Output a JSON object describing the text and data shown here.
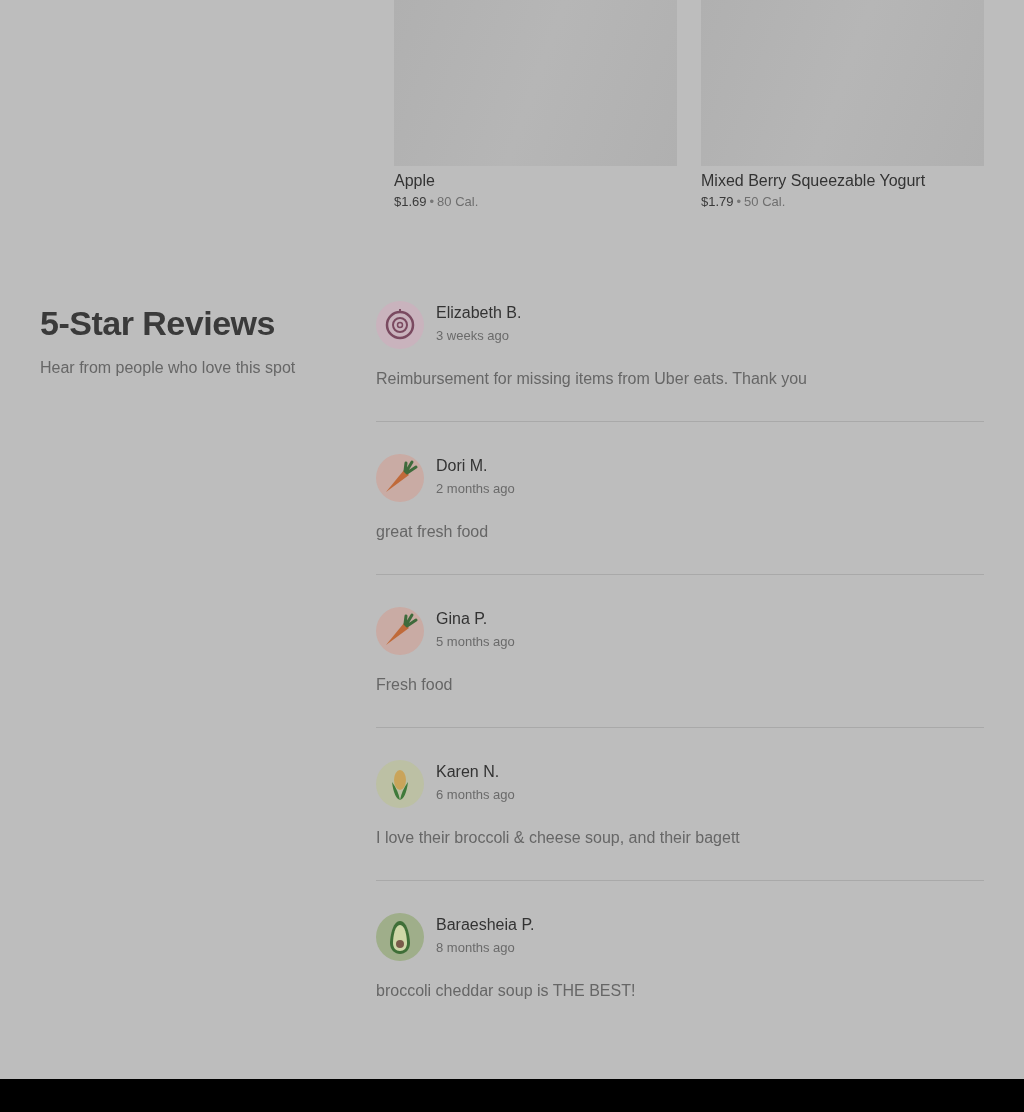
{
  "products": [
    {
      "name": "Apple",
      "price": "$1.69",
      "separator": "•",
      "calories": "80 Cal."
    },
    {
      "name": "Mixed Berry Squeezable Yogurt",
      "price": "$1.79",
      "separator": "•",
      "calories": "50 Cal."
    }
  ],
  "reviews_section": {
    "title": "5-Star Reviews",
    "subtitle": "Hear from people who love this spot"
  },
  "reviews": [
    {
      "kind": "onion",
      "name": "Elizabeth B.",
      "time": "3 weeks ago",
      "text": "Reimbursement for missing items from Uber eats. Thank you"
    },
    {
      "kind": "carrot",
      "name": "Dori M.",
      "time": "2 months ago",
      "text": "great fresh food"
    },
    {
      "kind": "carrot",
      "name": "Gina P.",
      "time": "5 months ago",
      "text": "Fresh food"
    },
    {
      "kind": "corn",
      "name": "Karen N.",
      "time": "6 months ago",
      "text": "I love their broccoli & cheese soup, and their bagett"
    },
    {
      "kind": "avocado",
      "name": "Baraesheia P.",
      "time": "8 months ago",
      "text": "broccoli cheddar soup is THE BEST!"
    }
  ]
}
